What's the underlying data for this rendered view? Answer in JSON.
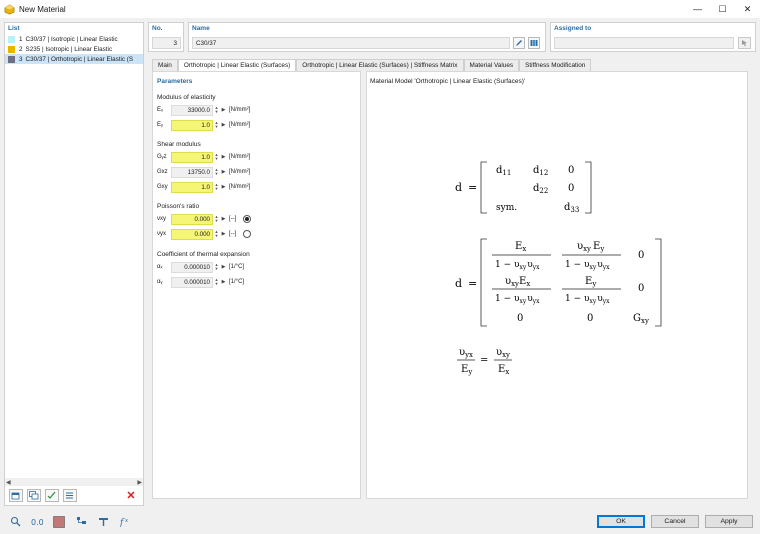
{
  "window": {
    "title": "New Material",
    "minimize": "—",
    "maximize": "☐",
    "close": "✕"
  },
  "list": {
    "label": "List",
    "items": [
      {
        "num": "1",
        "text": "C30/37 | Isotropic | Linear Elastic",
        "color": "#b9f0f5"
      },
      {
        "num": "2",
        "text": "S235 | Isotropic | Linear Elastic",
        "color": "#e8b400"
      },
      {
        "num": "3",
        "text": "C30/37 | Orthotropic | Linear Elastic (S",
        "color": "#6e6e84"
      }
    ]
  },
  "header": {
    "no_label": "No.",
    "no_value": "3",
    "name_label": "Name",
    "name_value": "C30/37",
    "assigned_label": "Assigned to",
    "assigned_value": ""
  },
  "tabs": [
    "Main",
    "Orthotropic | Linear Elastic (Surfaces)",
    "Orthotropic | Linear Elastic (Surfaces) | Stiffness Matrix",
    "Material Values",
    "Stiffness Modification"
  ],
  "params": {
    "title": "Parameters",
    "modulus": {
      "title": "Modulus of elasticity",
      "rows": [
        {
          "sym": "Eₓ",
          "value": "33000.0",
          "unit": "[N/mm²]",
          "yellow": false
        },
        {
          "sym": "Eᵧ",
          "value": "1.0",
          "unit": "[N/mm²]",
          "yellow": true
        }
      ]
    },
    "shear": {
      "title": "Shear modulus",
      "rows": [
        {
          "sym": "Gᵧz",
          "value": "1.0",
          "unit": "[N/mm²]",
          "yellow": true
        },
        {
          "sym": "Gxz",
          "value": "13750.0",
          "unit": "[N/mm²]",
          "yellow": false
        },
        {
          "sym": "Gxy",
          "value": "1.0",
          "unit": "[N/mm²]",
          "yellow": true
        }
      ]
    },
    "poisson": {
      "title": "Poisson's ratio",
      "rows": [
        {
          "sym": "νxy",
          "value": "0.000",
          "unit": "[--]",
          "yellow": true
        },
        {
          "sym": "νyx",
          "value": "0.000",
          "unit": "[--]",
          "yellow": true
        }
      ]
    },
    "thermal": {
      "title": "Coefficient of thermal expansion",
      "rows": [
        {
          "sym": "αₓ",
          "value": "0.000010",
          "unit": "[1/°C]",
          "yellow": false
        },
        {
          "sym": "αᵧ",
          "value": "0.000010",
          "unit": "[1/°C]",
          "yellow": false
        }
      ]
    }
  },
  "model": {
    "title": "Material Model 'Orthotropic | Linear Elastic (Surfaces)'",
    "d": "d",
    "eq": "=",
    "m1": {
      "d11": "d",
      "d11s": "11",
      "d12": "d",
      "d12s": "12",
      "z1": "0",
      "d22": "d",
      "d22s": "22",
      "z2": "0",
      "sym": "sym.",
      "d33": "d",
      "d33s": "33"
    },
    "m2": {
      "ex": "E",
      "exs": "x",
      "ey": "E",
      "eys": "y",
      "ups": "υ",
      "one_minus": "1 − ",
      "xy": "xy",
      "yx": "yx",
      "zero": "0",
      "g": "G",
      "gs": "xy"
    }
  },
  "buttons": {
    "ok": "OK",
    "cancel": "Cancel",
    "apply": "Apply"
  },
  "icons": {
    "accent": "#2b6ca3",
    "swatch_bottom": "#c07878"
  }
}
